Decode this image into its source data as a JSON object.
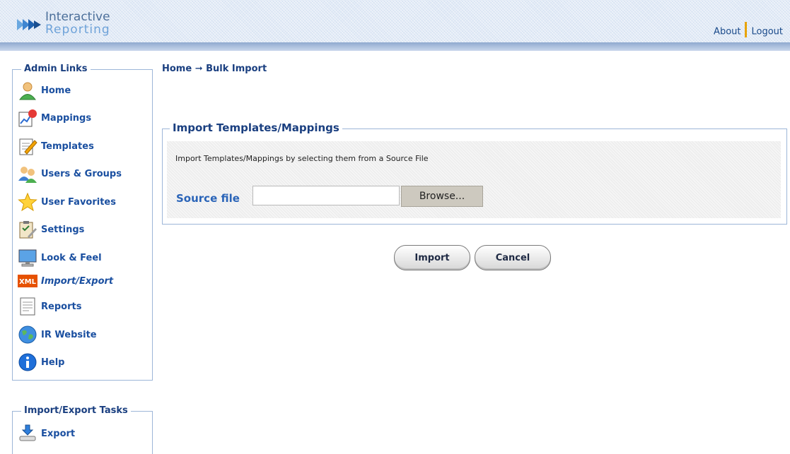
{
  "header": {
    "logo_line1": "Interactive",
    "logo_line2": "Reporting",
    "about": "About",
    "logout": "Logout"
  },
  "sidebar": {
    "title": "Admin Links",
    "items": [
      {
        "label": "Home",
        "icon": "user-icon"
      },
      {
        "label": "Mappings",
        "icon": "chart-icon"
      },
      {
        "label": "Templates",
        "icon": "notepad-pencil-icon"
      },
      {
        "label": "Users & Groups",
        "icon": "users-icon"
      },
      {
        "label": "User Favorites",
        "icon": "star-icon"
      },
      {
        "label": "Settings",
        "icon": "clipboard-settings-icon"
      },
      {
        "label": "Look & Feel",
        "icon": "monitor-icon"
      },
      {
        "label": "Import/Export",
        "icon": "xml-icon"
      },
      {
        "label": "Reports",
        "icon": "document-icon"
      },
      {
        "label": "IR Website",
        "icon": "globe-icon"
      },
      {
        "label": "Help",
        "icon": "info-icon"
      }
    ]
  },
  "tasks": {
    "title": "Import/Export Tasks",
    "items": [
      {
        "label": "Export",
        "icon": "export-icon"
      }
    ]
  },
  "breadcrumb": "Home ➞ Bulk Import",
  "import_panel": {
    "title": "Import Templates/Mappings",
    "description": "Import Templates/Mappings by selecting them from a Source File",
    "source_label": "Source file",
    "source_value": "",
    "browse_label": "Browse..."
  },
  "actions": {
    "import_label": "Import",
    "cancel_label": "Cancel"
  },
  "colors": {
    "link_blue": "#1a4fa0",
    "heading_navy": "#1a3f80",
    "separator_orange": "#e8a300"
  }
}
